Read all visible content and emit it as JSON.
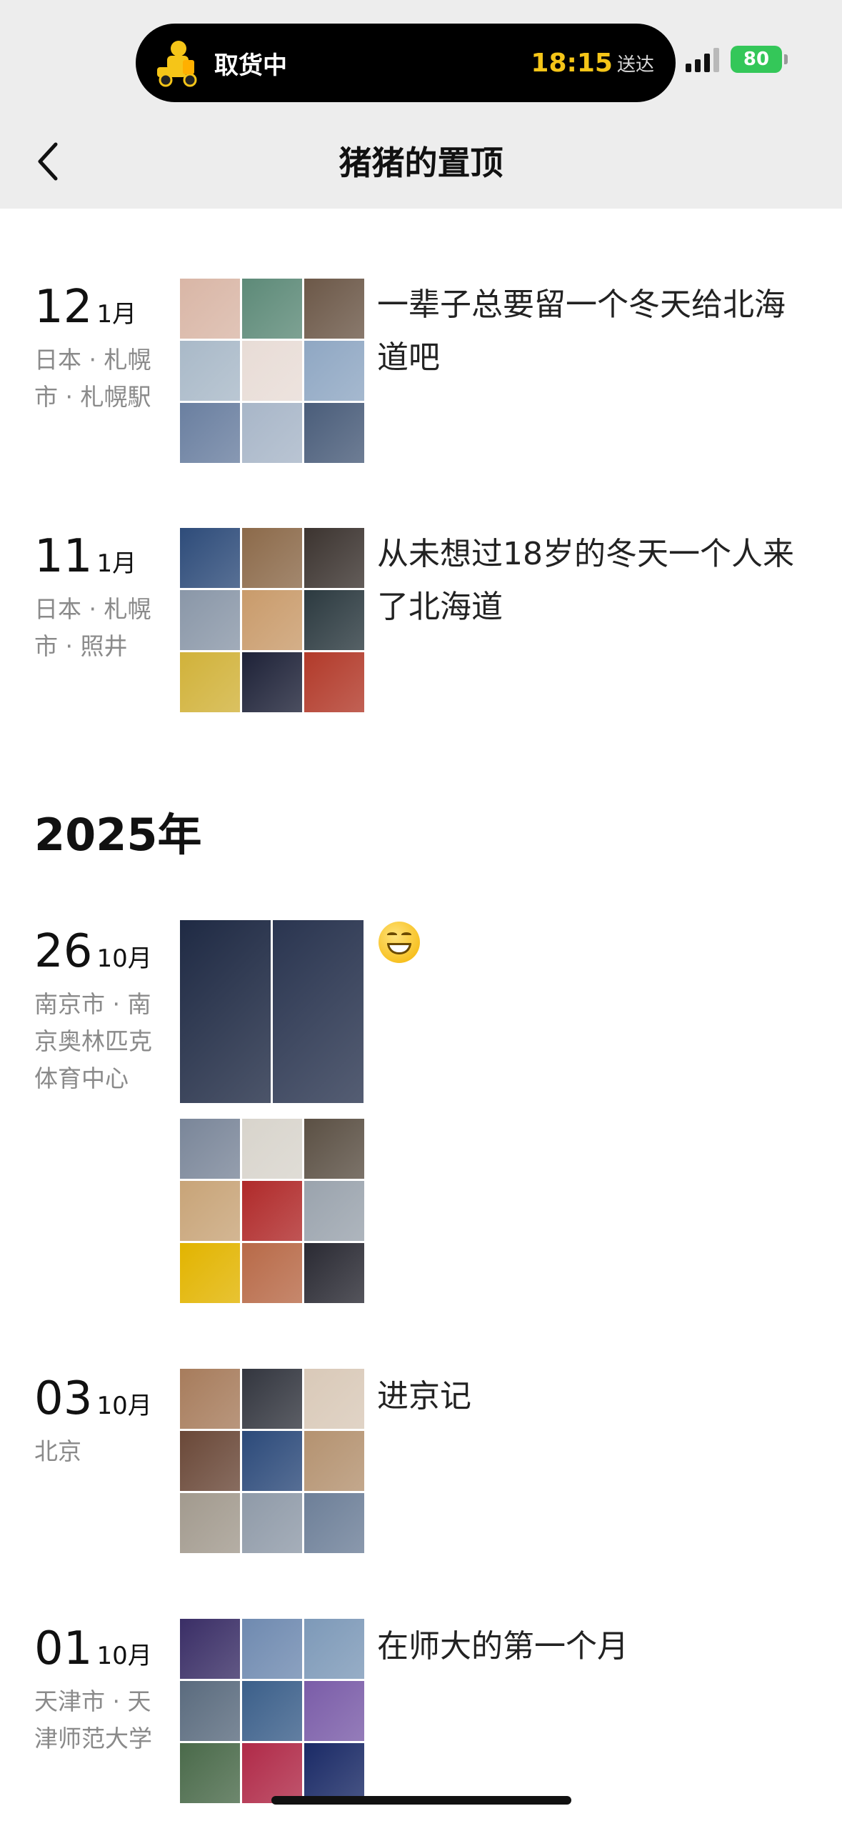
{
  "status_bar": {
    "activity_label": "取货中",
    "delivery_time": "18:15",
    "delivery_suffix": "送达",
    "battery": "80"
  },
  "nav": {
    "title": "猪猪的置顶"
  },
  "entries": [
    {
      "day": "12",
      "month": "1月",
      "location": "日本 · 札幌市 · 札幌駅",
      "caption": "一辈子总要留一个冬天给北海道吧",
      "photo_colors": [
        "#d9b6a6",
        "#5d8a78",
        "#6c5848",
        "#a9b9c8",
        "#e8dcd6",
        "#8fa7c3",
        "#6a7fa0",
        "#a8b6c8",
        "#4a5d7a"
      ]
    },
    {
      "day": "11",
      "month": "1月",
      "location": "日本 · 札幌市 · 照井",
      "caption": "从未想过18岁的冬天一个人来了北海道",
      "photo_colors": [
        "#2e4c7a",
        "#8c6a4a",
        "#3c3430",
        "#8a97a8",
        "#c99b6b",
        "#2c3a40",
        "#d1b23a",
        "#1e2238",
        "#b23a2a"
      ]
    },
    {
      "day": "26",
      "month": "10月",
      "location": "南京市 · 南京奥林匹克体育中心",
      "caption": "",
      "emoji": "grinning-face",
      "photo_colors": [
        "#1f2a44",
        "#2a3550"
      ],
      "photo_colors_b": [
        "#7a8699",
        "#d8d4cc",
        "#5b5044",
        "#c8a478",
        "#b02a2a",
        "#9aa3ad",
        "#e2b400",
        "#b86a48",
        "#2a2a33"
      ]
    },
    {
      "day": "03",
      "month": "10月",
      "location": "北京",
      "caption": "进京记",
      "photo_colors": [
        "#a77c5c",
        "#33363f",
        "#d9c9b8",
        "#6a4838",
        "#2c4a7a",
        "#b49270",
        "#a29a8e",
        "#8f9aa8",
        "#6d7f98"
      ]
    },
    {
      "day": "01",
      "month": "10月",
      "location": "天津市 · 天津师范大学",
      "caption": "在师大的第一个月",
      "photo_colors": [
        "#3a2e66",
        "#6f8ab0",
        "#7d99b8",
        "#5a6b7e",
        "#3b5f8a",
        "#7a5ca8",
        "#4a6a4a",
        "#b02a48",
        "#1a2a66"
      ]
    }
  ],
  "year_header": "2025年"
}
